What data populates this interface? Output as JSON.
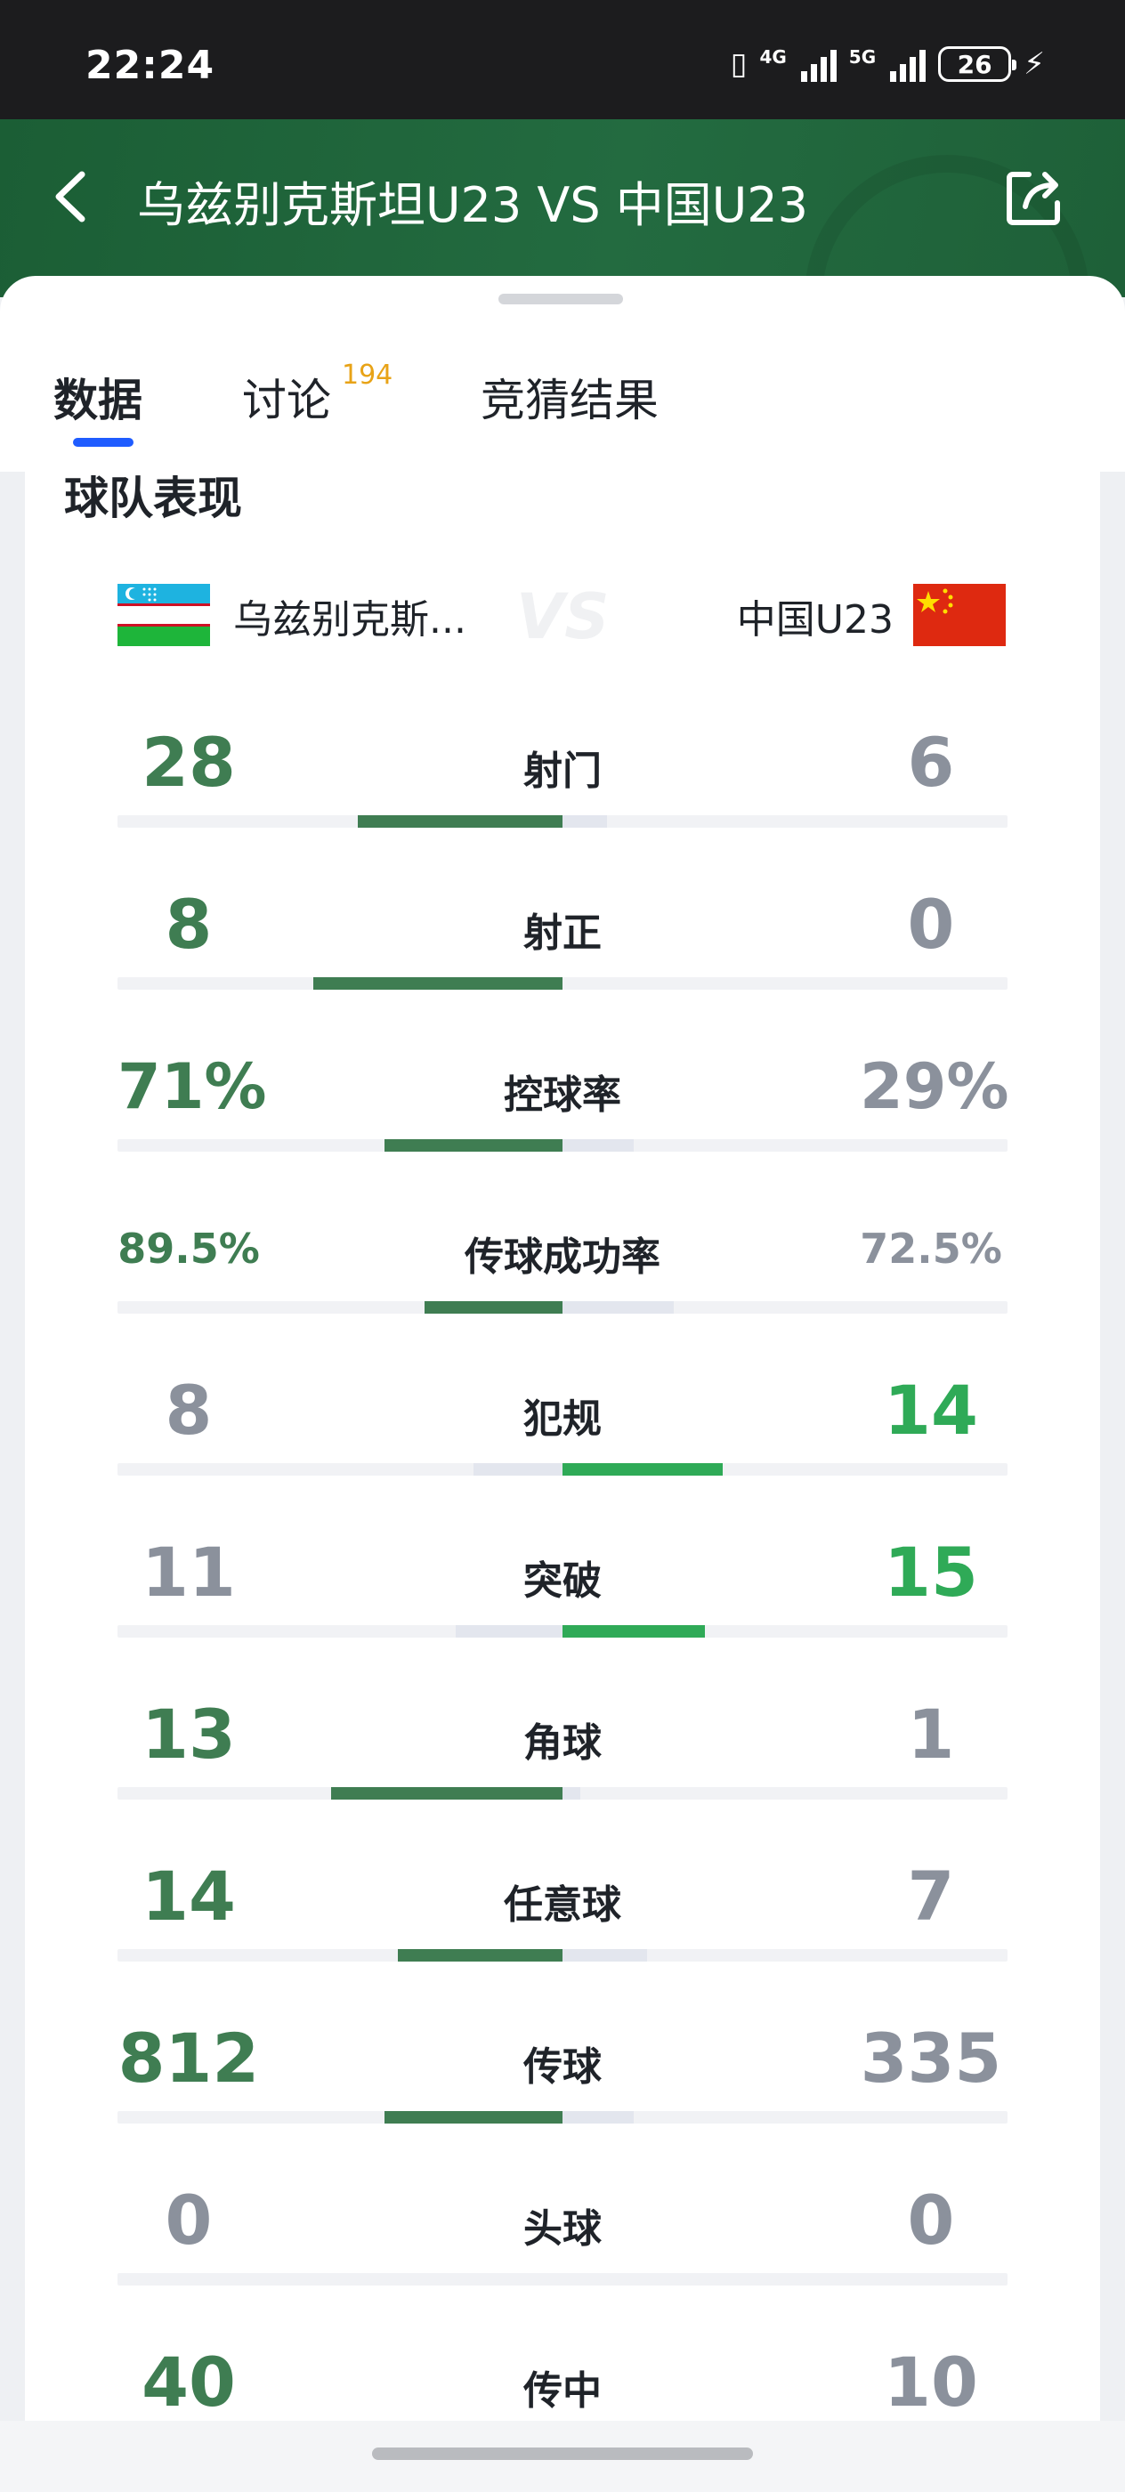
{
  "status_bar": {
    "time": "22:24",
    "network_1": "4G",
    "network_2": "5G",
    "battery": "26"
  },
  "header": {
    "title": "乌兹别克斯坦U23 VS 中国U23",
    "back_icon": "chevron-left-icon",
    "share_icon": "share-icon"
  },
  "tabs": [
    {
      "label": "数据",
      "badge": ""
    },
    {
      "label": "讨论",
      "badge": "194"
    },
    {
      "label": "竞猜结果",
      "badge": ""
    }
  ],
  "section_title": "球队表现",
  "teams": {
    "home": {
      "name": "乌兹别克斯...",
      "flag": "uzbekistan-flag"
    },
    "away": {
      "name": "中国U23",
      "flag": "china-flag"
    }
  },
  "colors": {
    "home_green": "#3f7d52",
    "away_green": "#2faa57",
    "loser_gray": "#8b919c",
    "track": "#f1f2f5",
    "loser_bar": "#e3e6ee",
    "tab_underline": "#1f5cff",
    "badge_orange": "#e8a317",
    "header_green": "#1e6038"
  },
  "stats": [
    {
      "label": "射门",
      "home": "28",
      "away": "6",
      "home_ratio": 0.46,
      "away_ratio": 0.1,
      "winner": "home",
      "style": "big"
    },
    {
      "label": "射正",
      "home": "8",
      "away": "0",
      "home_ratio": 0.56,
      "away_ratio": 0.0,
      "winner": "home",
      "style": "big"
    },
    {
      "label": "控球率",
      "home": "71%",
      "away": "29%",
      "home_ratio": 0.4,
      "away_ratio": 0.16,
      "winner": "home",
      "style": "pct"
    },
    {
      "label": "传球成功率",
      "home": "89.5%",
      "away": "72.5%",
      "home_ratio": 0.31,
      "away_ratio": 0.25,
      "winner": "home",
      "style": "small"
    },
    {
      "label": "犯规",
      "home": "8",
      "away": "14",
      "home_ratio": 0.2,
      "away_ratio": 0.36,
      "winner": "away",
      "style": "big"
    },
    {
      "label": "突破",
      "home": "11",
      "away": "15",
      "home_ratio": 0.24,
      "away_ratio": 0.32,
      "winner": "away",
      "style": "big"
    },
    {
      "label": "角球",
      "home": "13",
      "away": "1",
      "home_ratio": 0.52,
      "away_ratio": 0.04,
      "winner": "home",
      "style": "big"
    },
    {
      "label": "任意球",
      "home": "14",
      "away": "7",
      "home_ratio": 0.37,
      "away_ratio": 0.19,
      "winner": "home",
      "style": "big"
    },
    {
      "label": "传球",
      "home": "812",
      "away": "335",
      "home_ratio": 0.4,
      "away_ratio": 0.16,
      "winner": "home",
      "style": "big"
    },
    {
      "label": "头球",
      "home": "0",
      "away": "0",
      "home_ratio": 0.0,
      "away_ratio": 0.0,
      "winner": "none",
      "style": "big"
    },
    {
      "label": "传中",
      "home": "40",
      "away": "10",
      "home_ratio": 0.0,
      "away_ratio": 0.0,
      "winner": "home",
      "style": "big"
    }
  ]
}
